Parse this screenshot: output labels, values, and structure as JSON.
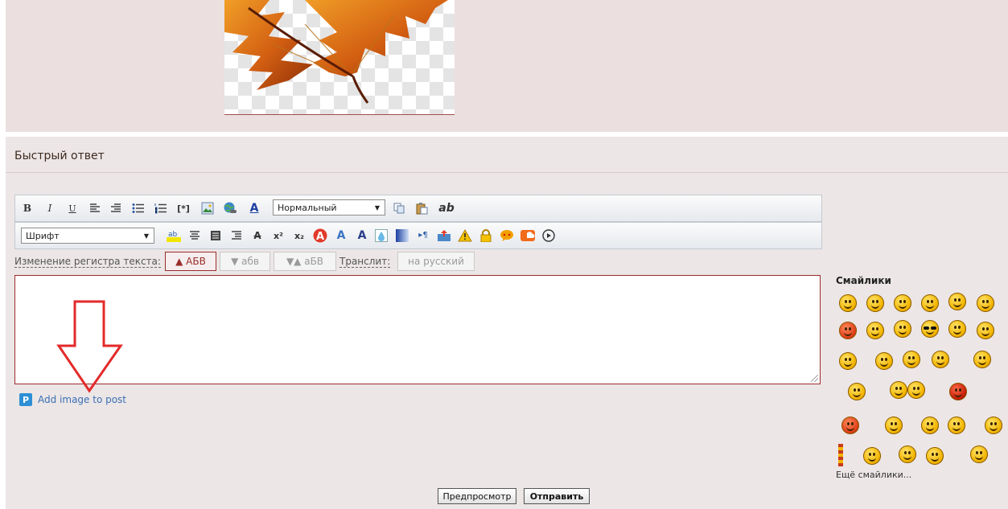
{
  "post": {
    "image_name": "maple-leaf-image"
  },
  "quick_reply": {
    "title": "Быстрый ответ"
  },
  "toolbar": {
    "row1": {
      "bold": "B",
      "italic": "I",
      "underline": "U",
      "size_select": "Нормальный",
      "spell": "ab"
    },
    "row2": {
      "font_select": "Шрифт"
    }
  },
  "case_change": {
    "label": "Изменение регистра текста:",
    "upper": "▲ АБВ",
    "lower": "▼ абв",
    "toggle": "▼▲ аБВ",
    "translit_label": "Транслит:",
    "translit_button": "на русский"
  },
  "editor": {
    "value": ""
  },
  "attach": {
    "p_label": "P",
    "label": "Add image to post"
  },
  "smilies": {
    "title": "Смайлики",
    "more": "Ещё смайлики..."
  },
  "actions": {
    "preview": "Предпросмотр",
    "send": "Отправить"
  },
  "colors": {
    "accent_border": "#9b2c2c",
    "link_blue": "#3a6fb5",
    "arrow_red": "#e32a2a",
    "panel_bg": "#ece6e6"
  }
}
